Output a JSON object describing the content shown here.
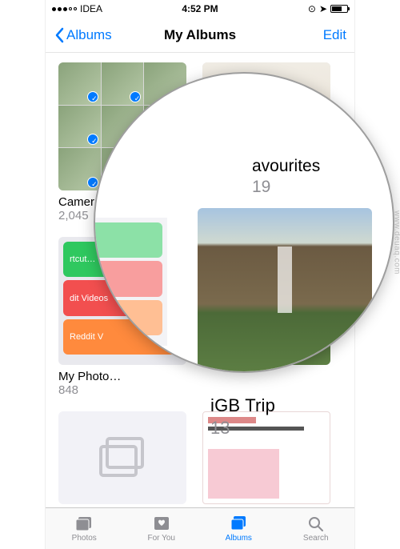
{
  "status": {
    "carrier": "IDEA",
    "time": "4:52 PM"
  },
  "nav": {
    "back_label": "Albums",
    "title": "My Albums",
    "edit_label": "Edit"
  },
  "albums": {
    "camera_roll": {
      "name": "Camera Roll",
      "count": "2,045"
    },
    "favourites": {
      "name": "Favourites",
      "name_partial": "avourites",
      "count": "19"
    },
    "my_photo_stream": {
      "name": "My Photo…",
      "count": "848"
    },
    "igb_trip": {
      "name": "iGB Trip",
      "count": "13"
    }
  },
  "shortcuts": {
    "a": "rtcut…",
    "b": "dit Videos",
    "c": "Reddit V"
  },
  "tabs": {
    "photos": "Photos",
    "for_you": "For You",
    "albums": "Albums",
    "search": "Search"
  },
  "watermark": "www.deuaq.com"
}
